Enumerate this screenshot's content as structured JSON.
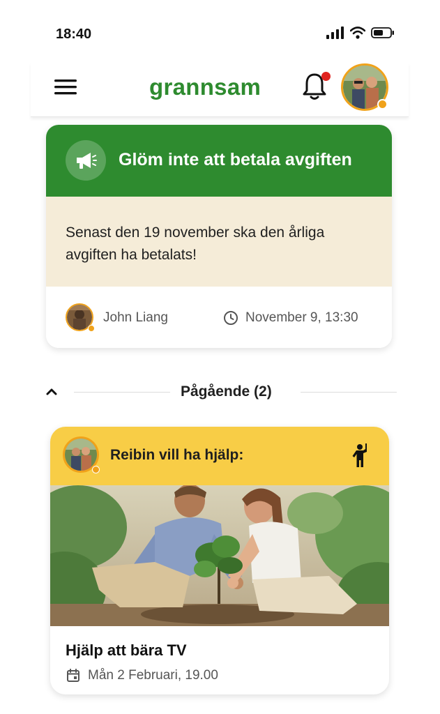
{
  "status_bar": {
    "time": "18:40",
    "icons": [
      "signal-icon",
      "wifi-icon",
      "battery-icon"
    ]
  },
  "header": {
    "logo": "grannsam",
    "icons": [
      "menu-icon",
      "bell-icon",
      "avatar"
    ],
    "notification_dot": true
  },
  "announcement": {
    "icon": "megaphone-icon",
    "title": "Glöm inte att betala avgiften",
    "body": "Senast den 19 november ska den årliga avgiften ha betalats!",
    "author": "John Liang",
    "timestamp": "November 9, 13:30"
  },
  "section": {
    "title": "Pågående (2)",
    "expanded": true
  },
  "help_request": {
    "label": "Reibin vill ha hjälp:",
    "type_icon": "person-raising-hand-icon",
    "image": "illustration of two people planting a small tree",
    "task_title": "Hjälp att bära TV",
    "task_date": "Mån 2 Februari, 19.00"
  },
  "colors": {
    "brand_green": "#2e8b2f",
    "announcement_body": "#f5ecd8",
    "help_header": "#f8cd46",
    "avatar_ring": "#f0a21a",
    "notification": "#e0231f"
  }
}
